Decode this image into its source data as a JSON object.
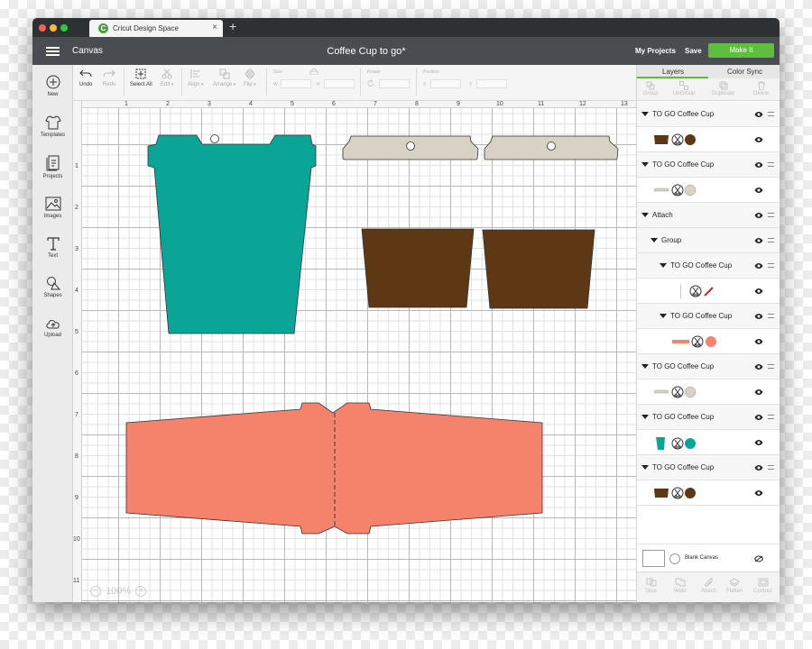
{
  "browser": {
    "tab_title": "Cricut Design Space",
    "tab_icon_letter": "C",
    "new_tab_symbol": "+",
    "close_symbol": "×"
  },
  "header": {
    "section": "Canvas",
    "title": "Coffee Cup to go*",
    "my_projects": "My Projects",
    "save": "Save",
    "make_it": "Make It"
  },
  "left_sidebar": {
    "items": [
      {
        "label": "New",
        "icon": "plus-circle-icon"
      },
      {
        "label": "Templates",
        "icon": "shirt-icon"
      },
      {
        "label": "Projects",
        "icon": "projects-icon"
      },
      {
        "label": "Images",
        "icon": "image-icon"
      },
      {
        "label": "Text",
        "icon": "text-icon"
      },
      {
        "label": "Shapes",
        "icon": "shapes-icon"
      },
      {
        "label": "Upload",
        "icon": "upload-icon"
      }
    ]
  },
  "toolbar": {
    "undo": "Undo",
    "redo": "Redo",
    "select_all": "Select All",
    "edit": "Edit",
    "align": "Align",
    "arrange": "Arrange",
    "flip": "Flip",
    "size_label": "Size",
    "w_label": "W",
    "h_label": "H",
    "rotate_label": "Rotate",
    "position_label": "Position",
    "x_label": "X",
    "y_label": "Y"
  },
  "canvas": {
    "zoom": "100%",
    "zoom_minus": "−",
    "zoom_plus": "+",
    "ruler_x": [
      "1",
      "2",
      "3",
      "4",
      "5",
      "6",
      "7",
      "8",
      "9",
      "10",
      "11",
      "12",
      "13"
    ],
    "ruler_y": [
      "1",
      "2",
      "3",
      "4",
      "5",
      "6",
      "7",
      "8",
      "9",
      "10",
      "11"
    ],
    "colors": {
      "teal": "#0aa597",
      "beige": "#d8d2c5",
      "brown": "#5e3715",
      "salmon": "#f5836c",
      "red": "#d8261c"
    }
  },
  "right_panel": {
    "tab_layers": "Layers",
    "tab_color_sync": "Color Sync",
    "actions": [
      "Group",
      "UnGroup",
      "Duplicate",
      "Delete"
    ],
    "layers": [
      {
        "name": "TO GO Coffee Cup",
        "kind": "group"
      },
      {
        "name": "",
        "kind": "items",
        "thumbs": [
          "brown-sleeve",
          "scissors",
          "brown-circle"
        ]
      },
      {
        "name": "TO GO Coffee Cup",
        "kind": "group"
      },
      {
        "name": "",
        "kind": "items",
        "thumbs": [
          "beige-lid",
          "scissors",
          "beige-circle"
        ]
      },
      {
        "name": "Attach",
        "kind": "group"
      },
      {
        "name": "Group",
        "kind": "group"
      },
      {
        "name": "TO GO Coffee Cup",
        "kind": "group"
      },
      {
        "name": "",
        "kind": "items",
        "thumbs": [
          "scissors",
          "red-line"
        ]
      },
      {
        "name": "TO GO Coffee Cup",
        "kind": "group"
      },
      {
        "name": "",
        "kind": "items",
        "thumbs": [
          "salmon-line",
          "scissors",
          "salmon-circle"
        ]
      },
      {
        "name": "TO GO Coffee Cup",
        "kind": "group"
      },
      {
        "name": "",
        "kind": "items",
        "thumbs": [
          "beige-lid",
          "scissors",
          "beige-circle"
        ]
      },
      {
        "name": "TO GO Coffee Cup",
        "kind": "group"
      },
      {
        "name": "",
        "kind": "items",
        "thumbs": [
          "teal-cup",
          "scissors",
          "teal-circle"
        ]
      },
      {
        "name": "TO GO Coffee Cup",
        "kind": "group"
      },
      {
        "name": "",
        "kind": "items",
        "thumbs": [
          "brown-sleeve",
          "scissors",
          "brown-circle"
        ]
      }
    ],
    "blank_canvas": "Blank Canvas",
    "bottom_actions": [
      "Slice",
      "Weld",
      "Attach",
      "Flatten",
      "Contour"
    ]
  }
}
